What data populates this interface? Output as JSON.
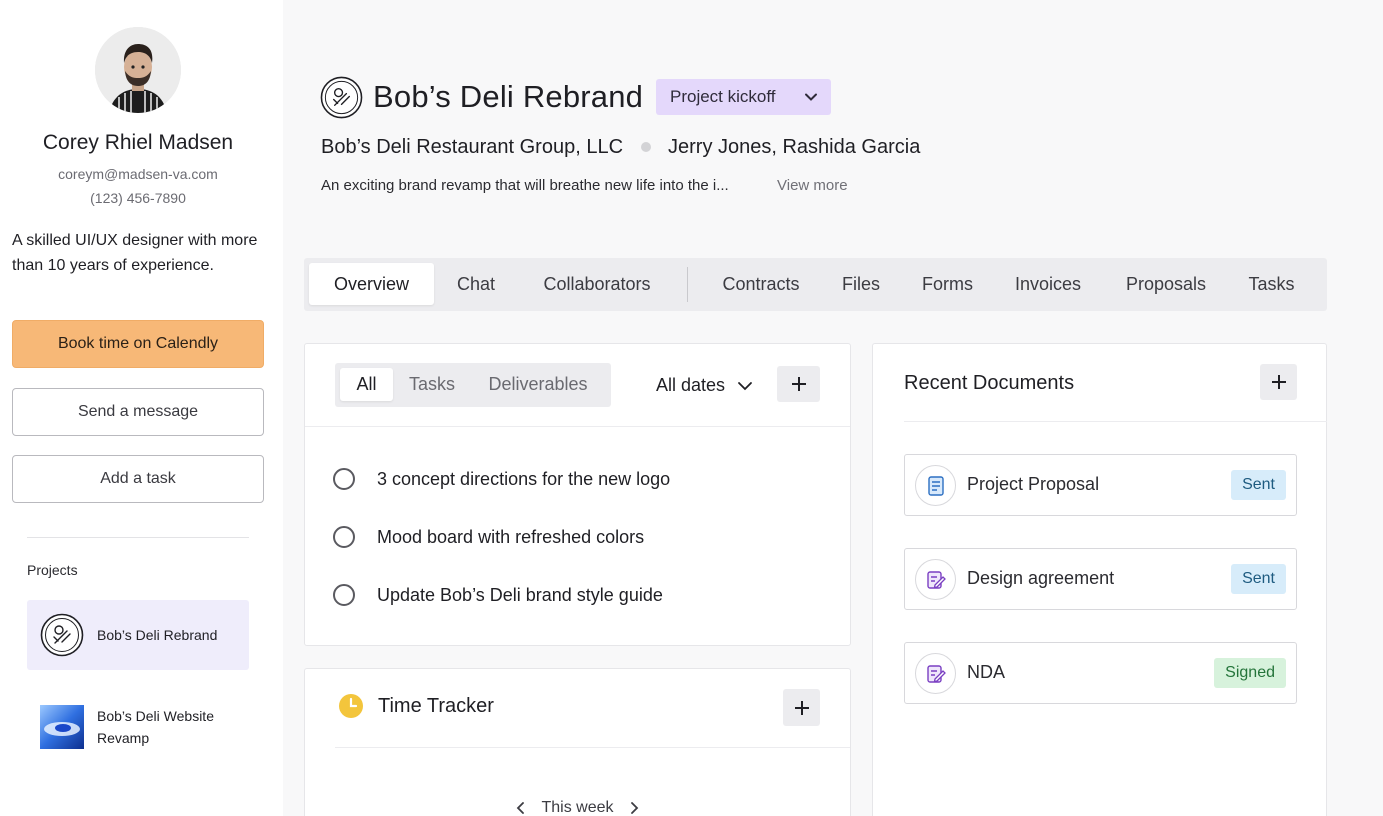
{
  "profile": {
    "name": "Corey Rhiel Madsen",
    "email": "coreym@madsen-va.com",
    "phone": "(123) 456-7890",
    "bio": "A skilled UI/UX designer with more than 10 years of experience."
  },
  "actions": {
    "calendly": "Book time on Calendly",
    "message": "Send a message",
    "task": "Add a task"
  },
  "projects": {
    "heading": "Projects",
    "items": [
      {
        "label": "Bob’s Deli Rebrand",
        "active": true
      },
      {
        "label": "Bob’s Deli Website Revamp",
        "active": false
      }
    ]
  },
  "header": {
    "title": "Bob’s Deli Rebrand",
    "stage": "Project kickoff",
    "client": "Bob’s Deli Restaurant Group, LLC",
    "collaborators": "Jerry Jones, Rashida Garcia",
    "description": "An exciting brand revamp that will breathe new life into the i...",
    "view_more": "View more"
  },
  "tabs": [
    "Overview",
    "Chat",
    "Collaborators",
    "Contracts",
    "Files",
    "Forms",
    "Invoices",
    "Proposals",
    "Tasks"
  ],
  "deliverables": {
    "filters": [
      "All",
      "Tasks",
      "Deliverables"
    ],
    "date_filter": "All dates",
    "items": [
      "3 concept directions for the new logo",
      "Mood board with refreshed colors",
      "Update Bob’s Deli brand style guide"
    ]
  },
  "time_tracker": {
    "title": "Time Tracker",
    "period": "This week"
  },
  "documents": {
    "title": "Recent Documents",
    "items": [
      {
        "name": "Project Proposal",
        "status": "Sent"
      },
      {
        "name": "Design agreement",
        "status": "Sent"
      },
      {
        "name": "NDA",
        "status": "Signed"
      }
    ]
  },
  "colors": {
    "accent_orange": "#f7b877",
    "stage_purple": "#e4d8fb",
    "active_project": "#efedfb",
    "badge_sent": "#d7ecfa",
    "badge_signed": "#d7f2dc"
  }
}
